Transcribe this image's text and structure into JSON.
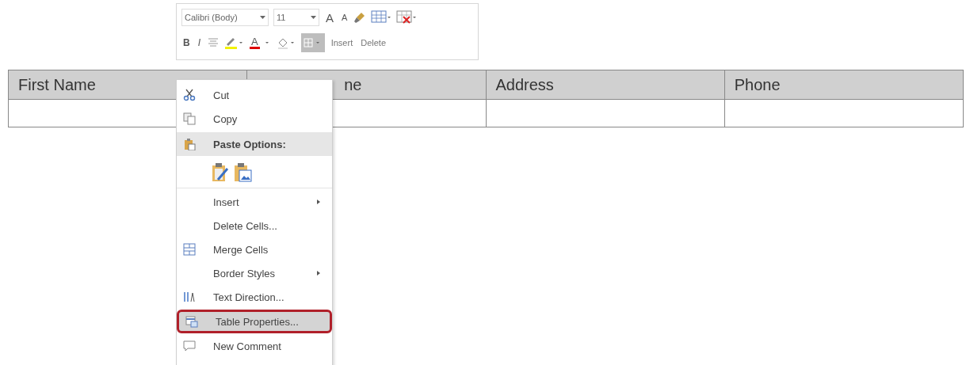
{
  "mini_toolbar": {
    "font": "Calibri (Body)",
    "size": "11",
    "grow_font": "A",
    "shrink_font": "A",
    "bold": "B",
    "italic": "I",
    "font_color": "A",
    "borders_selected": true,
    "insert": "Insert",
    "delete": "Delete"
  },
  "table": {
    "headers": [
      {
        "text": "First Name"
      },
      {
        "text": "ne"
      },
      {
        "text": "Address"
      },
      {
        "text": "Phone"
      }
    ],
    "rows": [
      [
        "",
        "",
        "",
        ""
      ]
    ]
  },
  "context_menu": {
    "items": [
      {
        "kind": "item",
        "label": "Cut",
        "submenu": false,
        "selected": false
      },
      {
        "kind": "item",
        "label": "Copy",
        "submenu": false,
        "selected": false
      },
      {
        "kind": "header",
        "label": "Paste Options:"
      },
      {
        "kind": "paste-icons"
      },
      {
        "kind": "item",
        "label": "Insert",
        "submenu": true,
        "selected": false
      },
      {
        "kind": "item",
        "label": "Delete Cells...",
        "submenu": false,
        "selected": false
      },
      {
        "kind": "item",
        "label": "Merge Cells",
        "submenu": false,
        "selected": false
      },
      {
        "kind": "item",
        "label": "Border Styles",
        "submenu": true,
        "selected": false
      },
      {
        "kind": "item",
        "label": "Text Direction...",
        "submenu": false,
        "selected": false
      },
      {
        "kind": "item",
        "label": "Table Properties...",
        "submenu": false,
        "selected": true
      },
      {
        "kind": "item",
        "label": "New Comment",
        "submenu": false,
        "selected": false
      }
    ]
  }
}
